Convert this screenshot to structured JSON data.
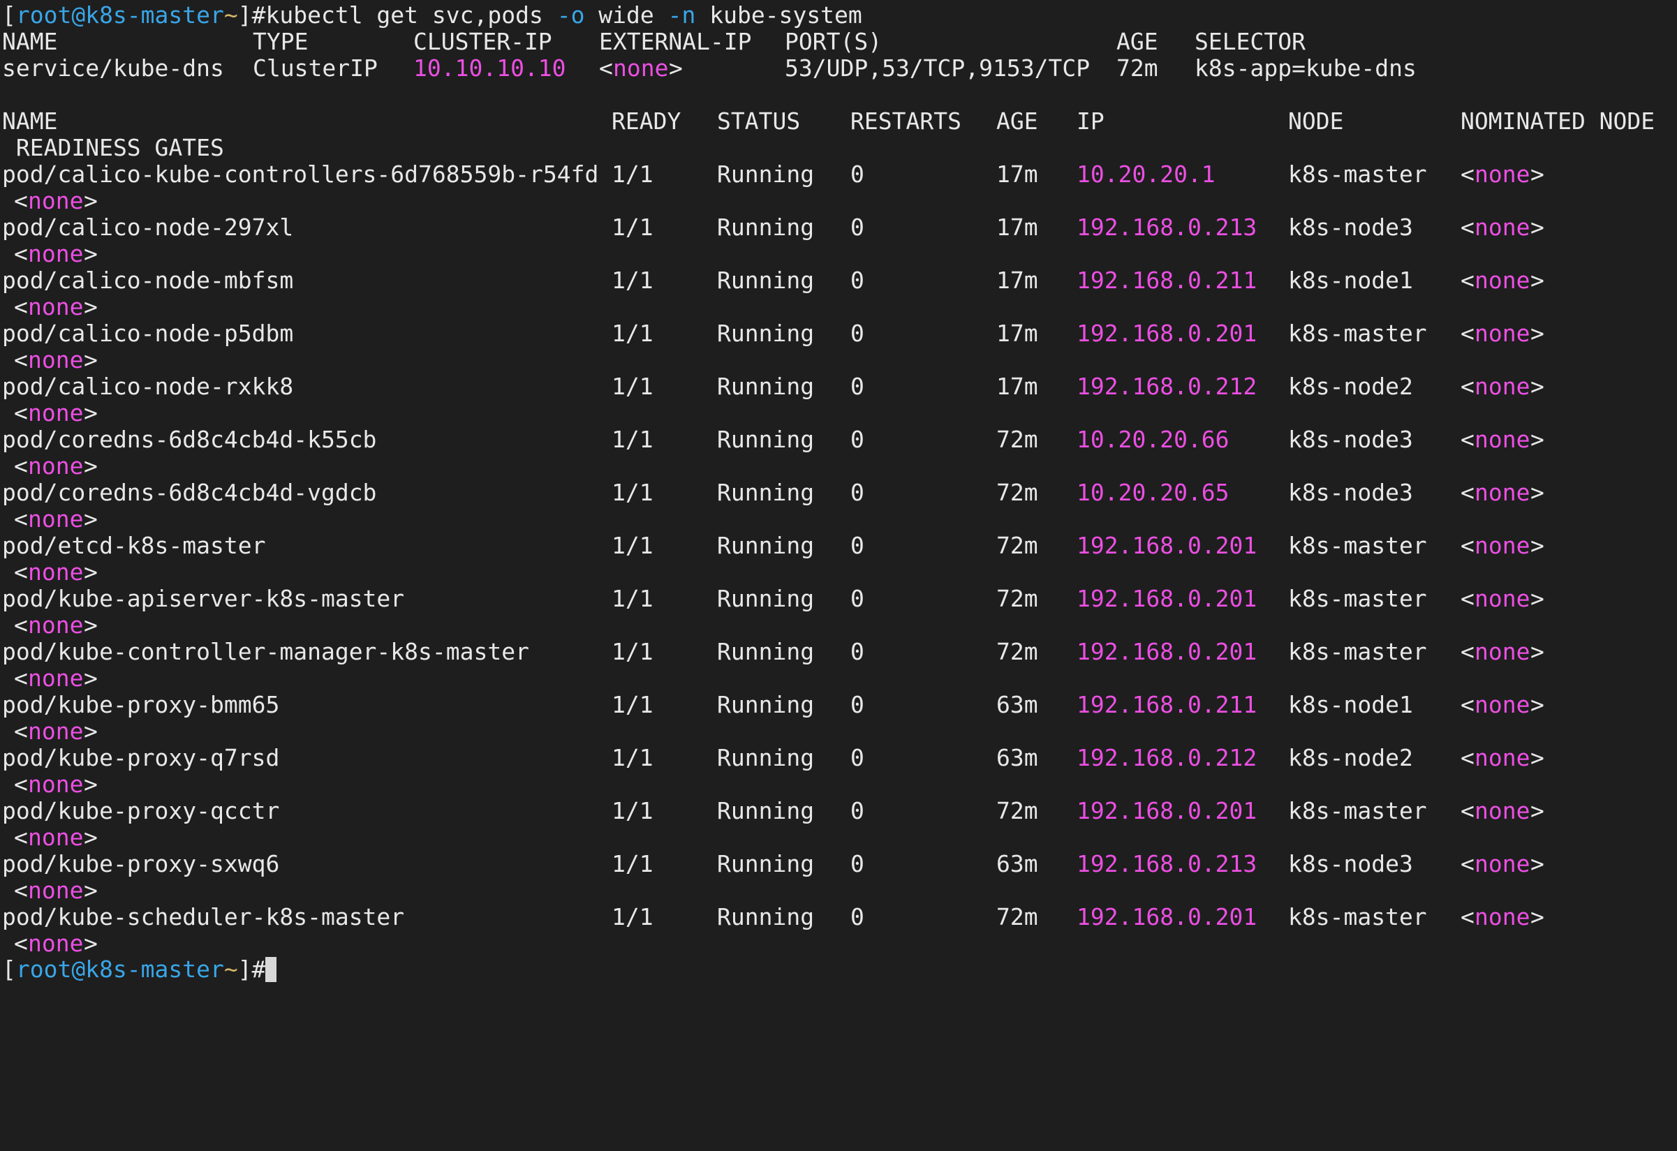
{
  "terminal": {
    "prompt": {
      "bracket_open": "[",
      "user_host": "root@k8s-master",
      "space": " ",
      "cwd": "~",
      "bracket_close_hash": "]#"
    },
    "command": {
      "part1": "kubectl get svc,pods ",
      "flag_o": "-o",
      "part2": " wide ",
      "flag_n": "-n",
      "part3": " kube-system"
    },
    "svc_headers": {
      "name": "NAME",
      "type": "TYPE",
      "cluster_ip": "CLUSTER-IP",
      "external_ip": "EXTERNAL-IP",
      "ports": "PORT(S)",
      "age": "AGE",
      "selector": "SELECTOR"
    },
    "svc_row": {
      "name": "service/kube-dns",
      "type": "ClusterIP",
      "cluster_ip": "10.10.10.10",
      "ext_open": "<",
      "ext_none": "none",
      "ext_close": ">",
      "ports": "53/UDP,53/TCP,9153/TCP",
      "age": "72m",
      "selector": "k8s-app=kube-dns"
    },
    "pod_headers": {
      "name": "NAME",
      "ready": "READY",
      "status": "STATUS",
      "restarts": "RESTARTS",
      "age": "AGE",
      "ip": "IP",
      "node": "NODE",
      "nominated": "NOMINATED NODE",
      "readiness": " READINESS GATES"
    },
    "none_open": "<",
    "none_word": "none",
    "none_close": ">",
    "none_indent": " ",
    "pods": [
      {
        "name": "pod/calico-kube-controllers-6d768559b-r54fd",
        "ready": "1/1",
        "status": "Running",
        "restarts": "0",
        "age": "17m",
        "ip": "10.20.20.1",
        "node": "k8s-master"
      },
      {
        "name": "pod/calico-node-297xl",
        "ready": "1/1",
        "status": "Running",
        "restarts": "0",
        "age": "17m",
        "ip": "192.168.0.213",
        "node": "k8s-node3"
      },
      {
        "name": "pod/calico-node-mbfsm",
        "ready": "1/1",
        "status": "Running",
        "restarts": "0",
        "age": "17m",
        "ip": "192.168.0.211",
        "node": "k8s-node1"
      },
      {
        "name": "pod/calico-node-p5dbm",
        "ready": "1/1",
        "status": "Running",
        "restarts": "0",
        "age": "17m",
        "ip": "192.168.0.201",
        "node": "k8s-master"
      },
      {
        "name": "pod/calico-node-rxkk8",
        "ready": "1/1",
        "status": "Running",
        "restarts": "0",
        "age": "17m",
        "ip": "192.168.0.212",
        "node": "k8s-node2"
      },
      {
        "name": "pod/coredns-6d8c4cb4d-k55cb",
        "ready": "1/1",
        "status": "Running",
        "restarts": "0",
        "age": "72m",
        "ip": "10.20.20.66",
        "node": "k8s-node3"
      },
      {
        "name": "pod/coredns-6d8c4cb4d-vgdcb",
        "ready": "1/1",
        "status": "Running",
        "restarts": "0",
        "age": "72m",
        "ip": "10.20.20.65",
        "node": "k8s-node3"
      },
      {
        "name": "pod/etcd-k8s-master",
        "ready": "1/1",
        "status": "Running",
        "restarts": "0",
        "age": "72m",
        "ip": "192.168.0.201",
        "node": "k8s-master"
      },
      {
        "name": "pod/kube-apiserver-k8s-master",
        "ready": "1/1",
        "status": "Running",
        "restarts": "0",
        "age": "72m",
        "ip": "192.168.0.201",
        "node": "k8s-master"
      },
      {
        "name": "pod/kube-controller-manager-k8s-master",
        "ready": "1/1",
        "status": "Running",
        "restarts": "0",
        "age": "72m",
        "ip": "192.168.0.201",
        "node": "k8s-master"
      },
      {
        "name": "pod/kube-proxy-bmm65",
        "ready": "1/1",
        "status": "Running",
        "restarts": "0",
        "age": "63m",
        "ip": "192.168.0.211",
        "node": "k8s-node1"
      },
      {
        "name": "pod/kube-proxy-q7rsd",
        "ready": "1/1",
        "status": "Running",
        "restarts": "0",
        "age": "63m",
        "ip": "192.168.0.212",
        "node": "k8s-node2"
      },
      {
        "name": "pod/kube-proxy-qcctr",
        "ready": "1/1",
        "status": "Running",
        "restarts": "0",
        "age": "72m",
        "ip": "192.168.0.201",
        "node": "k8s-master"
      },
      {
        "name": "pod/kube-proxy-sxwq6",
        "ready": "1/1",
        "status": "Running",
        "restarts": "0",
        "age": "63m",
        "ip": "192.168.0.213",
        "node": "k8s-node3"
      },
      {
        "name": "pod/kube-scheduler-k8s-master",
        "ready": "1/1",
        "status": "Running",
        "restarts": "0",
        "age": "72m",
        "ip": "192.168.0.201",
        "node": "k8s-master"
      }
    ],
    "colors": {
      "background": "#1e1e1e",
      "foreground": "#e8e8e8",
      "user_host": "#39a6e8",
      "cwd": "#d6b86a",
      "ip_and_none": "#ec4fe3",
      "cursor": "#d8d8d8"
    }
  }
}
